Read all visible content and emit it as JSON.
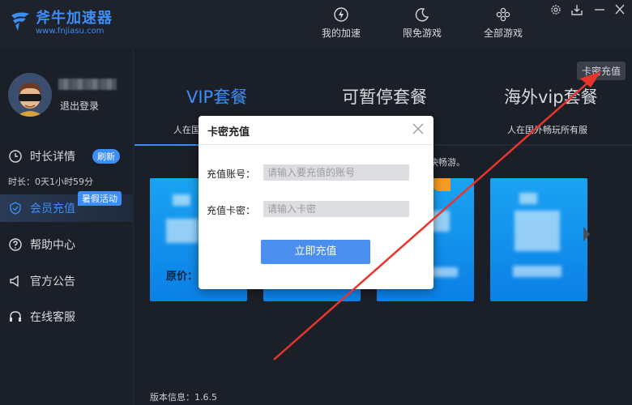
{
  "app": {
    "name": "斧牛加速器",
    "url": "www.fnjiasu.com"
  },
  "topnav": [
    {
      "label": "我的加速",
      "icon": "lightning-icon"
    },
    {
      "label": "限免游戏",
      "icon": "moon-icon"
    },
    {
      "label": "全部游戏",
      "icon": "grid-icon"
    }
  ],
  "sidebar": {
    "logout": "退出登录",
    "items": [
      {
        "label": "时长详情",
        "badge": "刷新"
      },
      {
        "label": "会员充值",
        "badge": "暑假活动"
      },
      {
        "label": "帮助中心"
      },
      {
        "label": "官方公告"
      },
      {
        "label": "在线客服"
      }
    ],
    "time_info": "时长：0天1小时59分"
  },
  "main": {
    "kami_button": "卡密充值",
    "tabs": [
      {
        "label": "VIP套餐",
        "sub": "人在国"
      },
      {
        "label": "可暂停套餐",
        "sub": ""
      },
      {
        "label": "海外vip套餐",
        "sub": "人在国外畅玩所有服"
      }
    ],
    "tip": "快畅游。",
    "price_label": "原价：",
    "version": "版本信息：1.6.5"
  },
  "dialog": {
    "title": "卡密充值",
    "account_label": "充值账号：",
    "account_placeholder": "请输入要充值的账号",
    "card_label": "充值卡密：",
    "card_placeholder": "请输入卡密",
    "submit": "立即充值"
  },
  "colors": {
    "accent": "#3c8df5",
    "background": "#1b1f27",
    "annotation_arrow": "#e8352c"
  }
}
